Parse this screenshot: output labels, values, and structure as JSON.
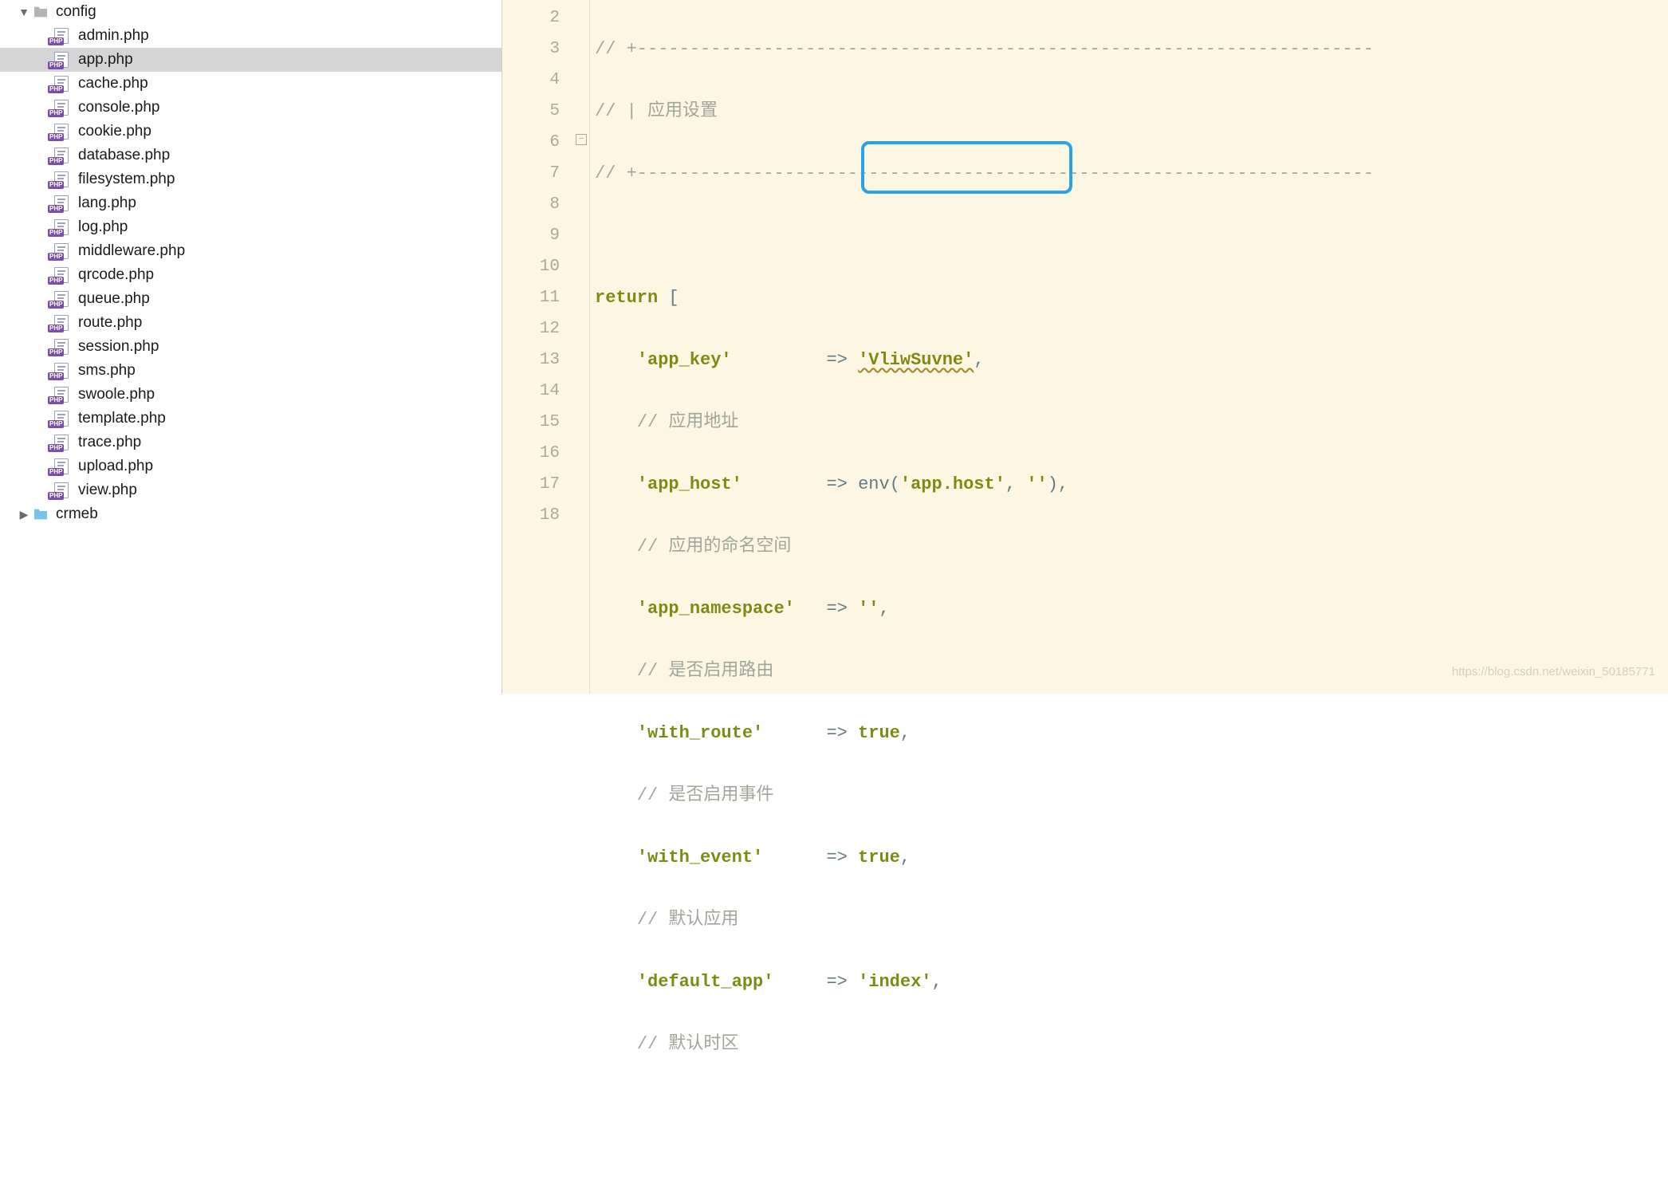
{
  "tree": {
    "root": {
      "name": "config",
      "expanded": true
    },
    "files": [
      "admin.php",
      "app.php",
      "cache.php",
      "console.php",
      "cookie.php",
      "database.php",
      "filesystem.php",
      "lang.php",
      "log.php",
      "middleware.php",
      "qrcode.php",
      "queue.php",
      "route.php",
      "session.php",
      "sms.php",
      "swoole.php",
      "template.php",
      "trace.php",
      "upload.php",
      "view.php"
    ],
    "sibling": {
      "name": "crmeb",
      "expanded": false
    },
    "selected": "app.php",
    "file_badge": "PHP"
  },
  "editor": {
    "first_line": 2,
    "last_line": 18,
    "content": {
      "c2": "// +----------------------------------------------------------------------",
      "c3": "// | 应用设置",
      "c4": "// +----------------------------------------------------------------------",
      "kw_return": "return",
      "brk_open": "[",
      "k_app_key": "'app_key'",
      "arrow": "=>",
      "v_app_key": "'VliwSuvne'",
      "comma": ",",
      "c8": "// 应用地址",
      "k_app_host": "'app_host'",
      "v_app_host_fn": "env",
      "v_app_host_a1": "'app.host'",
      "v_app_host_a2": "''",
      "c10": "// 应用的命名空间",
      "k_app_ns": "'app_namespace'",
      "v_app_ns": "''",
      "c12": "// 是否启用路由",
      "k_with_route": "'with_route'",
      "v_true": "true",
      "c14": "// 是否启用事件",
      "k_with_event": "'with_event'",
      "c16": "// 默认应用",
      "k_default_app": "'default_app'",
      "v_default_app": "'index'",
      "c18": "// 默认时区"
    }
  },
  "watermark": "https://blog.csdn.net/weixin_50185771"
}
